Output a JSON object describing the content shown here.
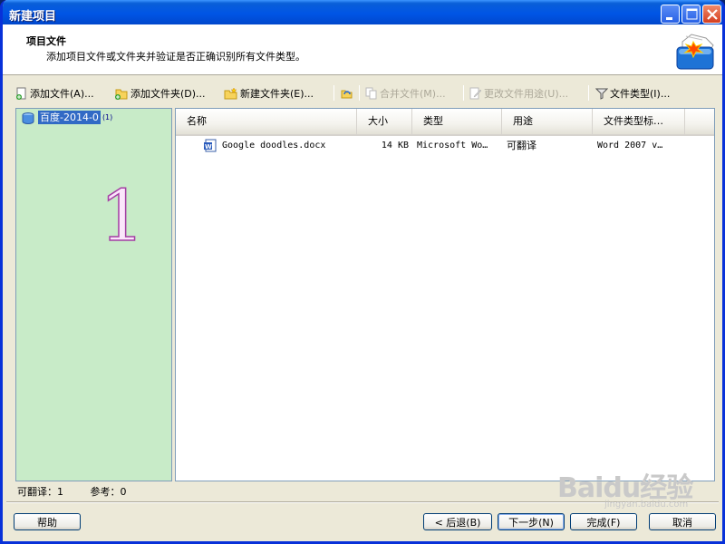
{
  "window": {
    "title": "新建项目"
  },
  "header": {
    "title": "项目文件",
    "description": "添加项目文件或文件夹并验证是否正确识别所有文件类型。"
  },
  "toolbar": {
    "add_file": "添加文件(A)...",
    "add_folder": "添加文件夹(D)...",
    "new_folder": "新建文件夹(E)...",
    "merge_files": "合并文件(M)...",
    "change_usage": "更改文件用途(U)...",
    "file_types": "文件类型(I)..."
  },
  "tree": {
    "item_label": "百度-2014-0",
    "item_count": "(1)",
    "overlay_number": "1"
  },
  "file_list": {
    "columns": [
      "名称",
      "大小",
      "类型",
      "用途",
      "文件类型标…"
    ],
    "rows": [
      {
        "name": "Google doodles.docx",
        "size": "14 KB",
        "type": "Microsoft Wo…",
        "usage": "可翻译",
        "filetype": "Word 2007 v…"
      }
    ]
  },
  "status": {
    "translatable": "可翻译：1",
    "reference": "参考：0"
  },
  "buttons": {
    "help": "帮助",
    "back": "< 后退(B)",
    "next": "下一步(N)",
    "finish": "完成(F)",
    "cancel": "取消"
  },
  "watermark": {
    "logo": "Baidu经验",
    "sub": "jingyan.baidu.com"
  },
  "colors": {
    "titlebar": "#0055e5",
    "tree_bg": "#c8ebc8",
    "selection": "#316ac5"
  }
}
